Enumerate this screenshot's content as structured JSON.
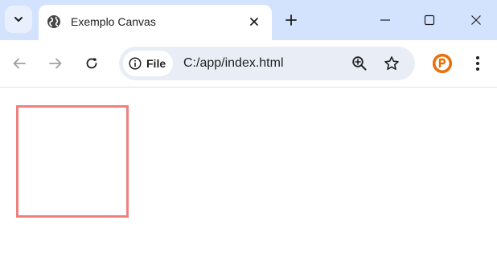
{
  "tab": {
    "title": "Exemplo Canvas",
    "favicon": "globe-icon"
  },
  "omnibox": {
    "security_label": "File",
    "url": "C:/app/index.html"
  },
  "icons": {
    "tab_search": "chevron-down-icon",
    "tab_close": "close-icon",
    "new_tab": "plus-icon",
    "minimize": "minimize-icon",
    "maximize": "maximize-icon",
    "close_window": "close-icon",
    "back": "arrow-left-icon",
    "forward": "arrow-right-icon",
    "reload": "reload-icon",
    "info": "info-icon",
    "zoom": "zoom-in-icon",
    "bookmark": "star-icon",
    "profile": "profile-avatar-icon",
    "menu": "kebab-menu-icon"
  },
  "colors": {
    "tabstrip_bg": "#d3e3fd",
    "omnibox_bg": "#e9eef6",
    "canvas_rect_stroke": "#f08080",
    "profile_bg": "#e8710a"
  },
  "canvas": {
    "shape": "stroked-rectangle",
    "stroke_color": "#f08080"
  }
}
